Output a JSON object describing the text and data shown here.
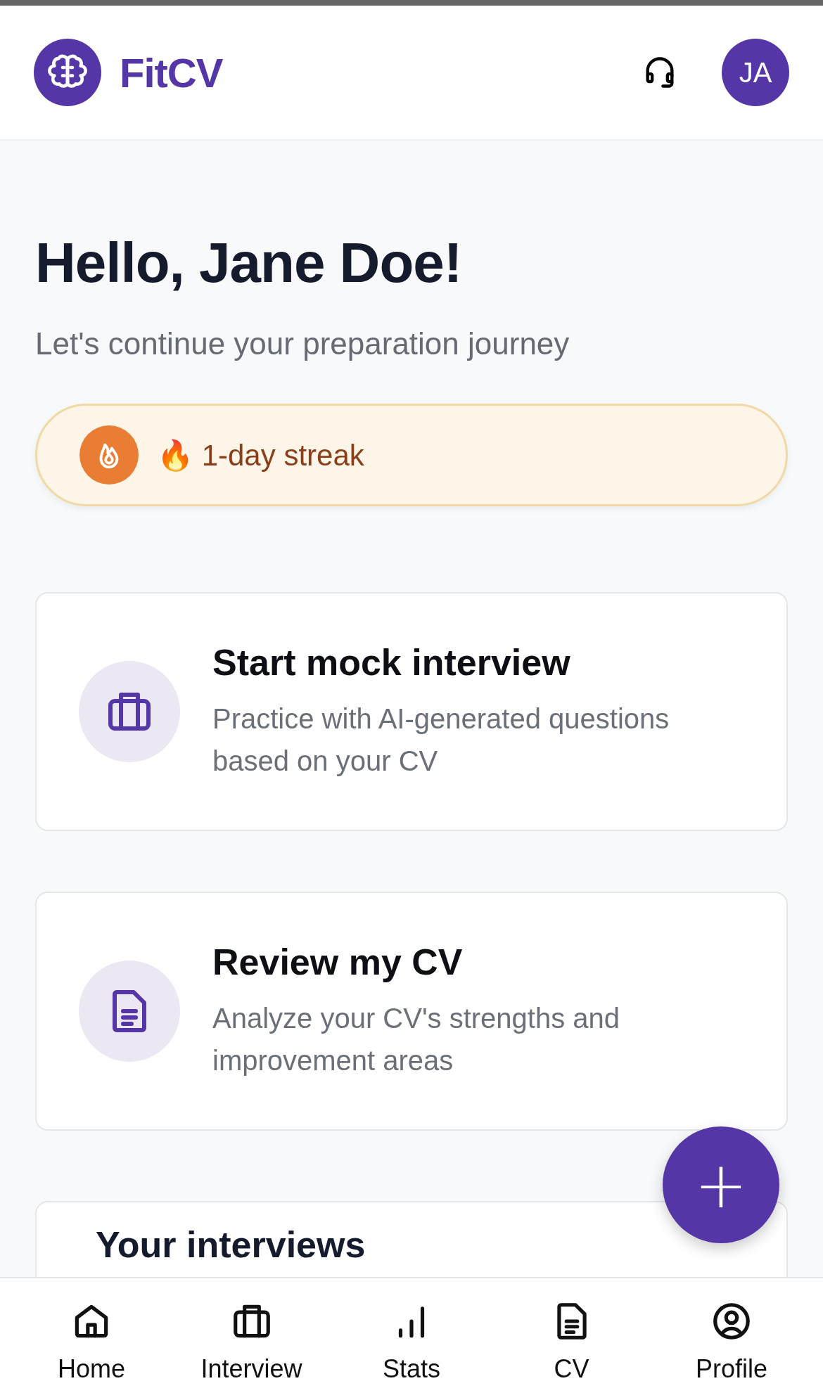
{
  "header": {
    "brand": "FitCV",
    "avatar": "JA"
  },
  "greeting": {
    "title": "Hello, Jane Doe!",
    "subtitle": "Let's continue your preparation journey"
  },
  "streak": {
    "emoji": "🔥",
    "label": "1-day streak"
  },
  "actions": [
    {
      "kind": "interview",
      "title": "Start mock interview",
      "description": "Practice with AI-generated questions based on your CV"
    },
    {
      "kind": "cv",
      "title": "Review my CV",
      "description": "Analyze your CV's strengths and improvement areas"
    }
  ],
  "interviews": {
    "title": "Your interviews"
  },
  "fab": {
    "label": "+"
  },
  "nav": [
    {
      "kind": "home",
      "label": "Home",
      "selected": false
    },
    {
      "kind": "interview",
      "label": "Interview",
      "selected": false
    },
    {
      "kind": "stats",
      "label": "Stats",
      "selected": false
    },
    {
      "kind": "cv",
      "label": "CV",
      "selected": false
    },
    {
      "kind": "profile",
      "label": "Profile",
      "selected": false
    }
  ]
}
